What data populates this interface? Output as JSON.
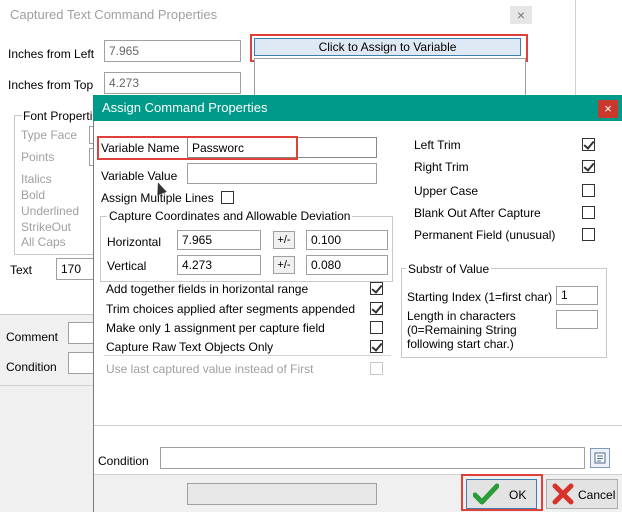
{
  "bg_window": {
    "title": "Captured Text Command Properties",
    "inches_from_left_label": "Inches from Left",
    "inches_from_left_value": "7.965",
    "inches_from_top_label": "Inches from Top",
    "inches_from_top_value": "4.273",
    "assign_button_label": "Click to Assign to Variable",
    "font_properties_label": "Font Propertie",
    "type_face_label": "Type Face",
    "points_label": "Points",
    "italics_label": "Italics",
    "bold_label": "Bold",
    "underlined_label": "Underlined",
    "strikeout_label": "StrikeOut",
    "all_caps_label": "All Caps",
    "text_label": "Text",
    "text_value": "170",
    "comment_label": "Comment",
    "condition_label": "Condition",
    "close_glyph": "×"
  },
  "dialog": {
    "title": "Assign Command Properties",
    "close_glyph": "×",
    "variable_name_label": "Variable Name",
    "variable_name_value": "Passworc",
    "variable_value_label": "Variable Value",
    "variable_value_value": "",
    "assign_multiple_lines_label": "Assign Multiple Lines",
    "capture_group_title": "Capture Coordinates and Allowable Deviation",
    "horizontal_label": "Horizontal",
    "horizontal_value": "7.965",
    "horizontal_pm_label": "+/-",
    "horizontal_dev_value": "0.100",
    "vertical_label": "Vertical",
    "vertical_value": "4.273",
    "vertical_pm_label": "+/-",
    "vertical_dev_value": "0.080",
    "opt_add_together": "Add together fields in horizontal range",
    "opt_trim_choices": "Trim choices applied after segments appended",
    "opt_make_only_one": "Make only 1 assignment per capture field",
    "opt_capture_raw": "Capture Raw Text Objects Only",
    "opt_use_last": "Use last captured value instead of First",
    "left_trim_label": "Left Trim",
    "right_trim_label": "Right Trim",
    "upper_case_label": "Upper Case",
    "blank_out_label": "Blank Out After Capture",
    "permanent_field_label": "Permanent Field (unusual)",
    "substr_group_title": "Substr of Value",
    "starting_index_label": "Starting Index (1=first char)",
    "starting_index_value": "1",
    "length_label_1": "Length in characters",
    "length_label_2": "(0=Remaining String",
    "length_label_3": "following start char.)",
    "length_value": "",
    "condition_label": "Condition",
    "condition_value": "",
    "ok_label": "OK",
    "cancel_label": "Cancel"
  },
  "colors": {
    "dialog_title_bg": "#009a8a",
    "close_red": "#c8382c",
    "highlight_red": "#e0403a",
    "footer_bg": "#f0f0f0"
  }
}
